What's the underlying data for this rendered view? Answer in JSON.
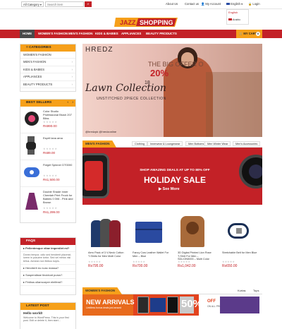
{
  "topbar": {
    "category_select": "All Category",
    "search_placeholder": "Search item",
    "links": [
      "About Us",
      "Contact us",
      "My Account"
    ],
    "languages": [
      "English",
      "Arabic"
    ],
    "login": "Login"
  },
  "logo": {
    "text1": "JAZZ",
    "text2": "SHOPPING"
  },
  "nav": {
    "items": [
      "HOME",
      "WOMEN'S FASHION",
      "MEN'S FASHION",
      "KIDS & BABIES",
      "APPLIANCES",
      "BEAUTY PRODUCTS"
    ],
    "cart": "MY CART",
    "cart_count": "0"
  },
  "categories": {
    "title": "CATEGORIES",
    "items": [
      "WOMEN'S FASHION",
      "MEN'S FASHION",
      "KIDS & BABIES",
      "APPLIANCES",
      "BEAUTY PRODUCTS"
    ]
  },
  "bestsellers": {
    "title": "BEST SELLERS",
    "items": [
      {
        "title": "Color Studio Professional Blush 207 Bliss",
        "price": "Rs990.00"
      },
      {
        "title": "Esprit lana ama",
        "price": "Rs89.00"
      },
      {
        "title": "Fidget Spinner DT0000",
        "price": "Rs1,500.00"
      },
      {
        "title": "Double Shade Inner Cheetah Print Frock for Babies 0 006 - Pink and Brown",
        "price": "Rs1,299.00"
      }
    ]
  },
  "faqs": {
    "title": "FAQS",
    "items": [
      "Pellentesque vitae imperdiet mi?",
      "Donec tempor, odio sed hendrerit placerat, lorem in posuere tortor. Sed vel metus nisi tellus. Aenean non finibus turpis.",
      "Hendrerit eu nunc massa?",
      "Suspendisse tincidunt purus?",
      "Finibus ullamcorper eleifend?"
    ]
  },
  "latest_post": {
    "title": "LATEST POST",
    "post_title": "Hello world!",
    "post_excerpt": "Welcome to WordPress. This is your first post. Edit or delete it, then start..."
  },
  "slider": {
    "brand": "HREDZ",
    "line1": "THE BIG OFFER O",
    "discount": "20%",
    "collection": "Lawn Collection",
    "year": "18",
    "sub": "UNSTITCHED 2PIECE COLLECTION",
    "social": "@hredzpk  @hredzonline"
  },
  "mens_section": {
    "title": "MEN'S FASHION",
    "tabs": [
      "Clothing",
      "Innerwear & Loungewear",
      "Men Bottoms",
      "Men Winter Wear",
      "Men's Accessories"
    ]
  },
  "banner1": {
    "line1": "SHOP AMAZING DEALS AT UP TO 80% OFF",
    "headline": "HOLIDAY SALE",
    "cta": "See More"
  },
  "products": [
    {
      "title": "Aero Pack of 3 V-Neck Cotton T-Shirts for Men Multi Color",
      "price": "Rs795.00"
    },
    {
      "title": "Fancy Cow Leather Wallet For Men – Blue",
      "price": "Rs700.00"
    },
    {
      "title": "3D Digital Printed Lion Rose T-Shirt For Men – SDLION5000 – Multi Color",
      "price": "Rs1,042.00"
    },
    {
      "title": "Stretchable Belt for Men Blue",
      "price": "Rs650.00"
    }
  ],
  "womens_section": {
    "title": "WOMEN'S FASHION",
    "tabs": [
      "Kurtas",
      "Tops"
    ]
  },
  "banner2": {
    "headline": "NEW ARRIVALS",
    "sub": "Limitless bonus deals just around",
    "pct": "50%",
    "off": "OFF",
    "note": "ON ALL PRODUCTS"
  },
  "colors": {
    "brand_red": "#c32127",
    "accent_orange": "#f6a01a"
  }
}
